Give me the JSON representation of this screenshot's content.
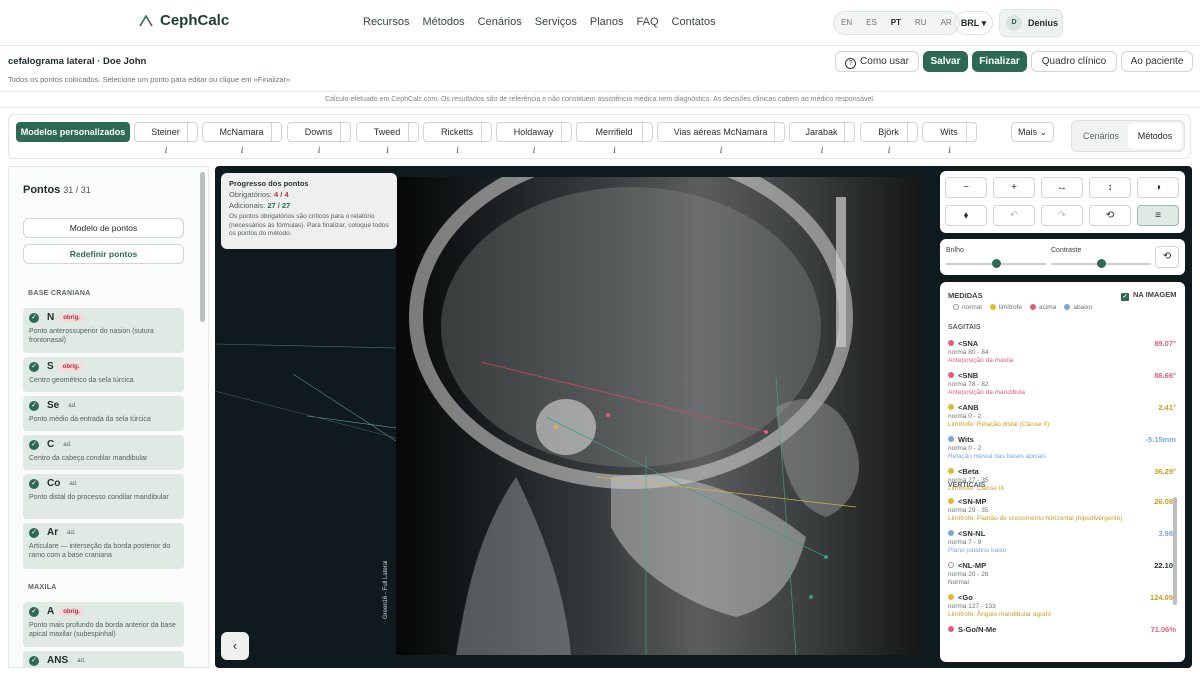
{
  "app": {
    "name": "CephCalc"
  },
  "nav": {
    "links": [
      "Recursos",
      "Métodos",
      "Cenários",
      "Serviços",
      "Planos",
      "FAQ",
      "Contatos"
    ]
  },
  "languages": [
    "EN",
    "ES",
    "PT",
    "RU",
    "AR"
  ],
  "active_language": "PT",
  "currency": "BRL ▾",
  "user": {
    "initial": "D",
    "name": "Denius"
  },
  "document": {
    "title": "cefalograma lateral · Doe John",
    "subtitle": "Todos os pontos colocados. Selecione um ponto para editar ou clique em «Finalizar»"
  },
  "actions": {
    "how_to": "Como usar",
    "save": "Salvar",
    "finish": "Finalizar",
    "clinical": "Quadro clínico",
    "patient": "Ao paciente"
  },
  "disclaimer": "Cálculo efetuado em CephCalc.com. Os resultados são de referência e não constituem assistência médica nem diagnóstico. As decisões clínicas cabem ao médico responsável.",
  "methods": {
    "custom": "Modelos personalizados",
    "info_glyph": "i",
    "items": [
      "Steiner",
      "McNamara",
      "Downs",
      "Tweed",
      "Ricketts",
      "Holdaway",
      "Merrifield",
      "Vias aéreas McNamara",
      "Jarabak",
      "Björk",
      "Wits"
    ],
    "more": "Mais ⌄",
    "toggle": [
      "Cenários",
      "Métodos"
    ],
    "toggle_active": "Métodos"
  },
  "sidebar": {
    "title": "Pontos",
    "count": "31 / 31",
    "model_button": "Modelo de pontos",
    "reset_button": "Redefinir pontos",
    "sections": [
      {
        "name": "BASE CRANIANA",
        "points": [
          {
            "code": "N",
            "tag": "obrig.",
            "required": true,
            "desc": "Ponto anterossuperior do nasion (sutura frontonasal)"
          },
          {
            "code": "S",
            "tag": "obrig.",
            "required": true,
            "desc": "Centro geométrico da sela túrcica"
          },
          {
            "code": "Se",
            "tag": "ad.",
            "required": false,
            "desc": "Ponto médio da entrada da sela túrcica"
          },
          {
            "code": "C",
            "tag": "ad.",
            "required": false,
            "desc": "Centro da cabeça condilar mandibular"
          },
          {
            "code": "Co",
            "tag": "ad.",
            "required": false,
            "desc": "Ponto distal do processo condilar mandibular"
          },
          {
            "code": "Ar",
            "tag": "ad.",
            "required": false,
            "desc": "Articulare — interseção da borda posterior do ramo com a base craniana"
          }
        ]
      },
      {
        "name": "MAXILA",
        "points": [
          {
            "code": "A",
            "tag": "obrig.",
            "required": true,
            "desc": "Ponto mais profundo da borda anterior da base apical maxilar (subespinhal)"
          },
          {
            "code": "ANS",
            "tag": "ad.",
            "required": false,
            "desc": ""
          }
        ]
      }
    ]
  },
  "progress": {
    "title": "Progresso dos pontos",
    "required_label": "Obrigatórios:",
    "required_value": "4 / 4",
    "additional_label": "Adicionais:",
    "additional_value": "27 / 27",
    "note": "Os pontos obrigatórios são críticos para o relatório (necessários às fórmulas). Para finalizar, coloque todos os pontos do método."
  },
  "image_label": "Green16 - Full Lateral",
  "tools": {
    "row1": [
      "−",
      "+",
      "↔",
      "↕",
      "◑"
    ],
    "row2": [
      "⬧",
      "↶",
      "↷",
      "⟲",
      "≡"
    ]
  },
  "adjust": {
    "brightness_label": "Brilho",
    "contrast_label": "Contraste",
    "brightness": 0.5,
    "contrast": 0.5,
    "reset": "⟲"
  },
  "measures": {
    "title": "MEDIDAS",
    "on_image": "NA IMAGEM",
    "legend": [
      {
        "label": "normal",
        "color": "#ffffff"
      },
      {
        "label": "limítrofe",
        "color": "#e3b92e"
      },
      {
        "label": "acima",
        "color": "#e0607a"
      },
      {
        "label": "abaixo",
        "color": "#7ea6d6"
      }
    ],
    "groups": [
      {
        "name": "SAGITAIS",
        "items": [
          {
            "name": "<SNA",
            "norm": "norma 80 - 84",
            "value": "89.07°",
            "status": "Anteposição da maxila",
            "color": "#e0607a"
          },
          {
            "name": "<SNB",
            "norm": "norma 78 - 82",
            "value": "86.66°",
            "status": "Anteposição da mandíbula",
            "color": "#e0607a"
          },
          {
            "name": "<ANB",
            "norm": "norma 0 - 2",
            "value": "2.41°",
            "status": "Limítrofe: Relação distal (Classe II)",
            "color": "#e3b92e"
          },
          {
            "name": "Wits",
            "norm": "norma 0 - 2",
            "value": "-5.15mm",
            "status": "Relação mesial das bases apicais",
            "color": "#7ea6d6"
          },
          {
            "name": "<Beta",
            "norm": "norma 27 - 35",
            "value": "36.29°",
            "status": "Limítrofe: Classe III",
            "color": "#e3b92e"
          }
        ]
      },
      {
        "name": "VERTICAIS",
        "items": [
          {
            "name": "<SN-MP",
            "norm": "norma 29 - 35",
            "value": "26.08°",
            "status": "Limítrofe: Padrão de crescimento horizontal (hipodivergente)",
            "color": "#e3b92e"
          },
          {
            "name": "<SN-NL",
            "norm": "norma 7 - 9",
            "value": "3.98°",
            "status": "Plano palatino baixo",
            "color": "#7ea6d6"
          },
          {
            "name": "<NL-MP",
            "norm": "norma 20 - 26",
            "value": "22.10°",
            "status": "Normal",
            "color": "#ffffff"
          },
          {
            "name": "<Go",
            "norm": "norma 127 - 133",
            "value": "124.09°",
            "status": "Limítrofe: Ângulo mandibular agudo",
            "color": "#e3b92e"
          },
          {
            "name": "S-Go/N-Me",
            "norm": "",
            "value": "71.06%",
            "status": "",
            "color": "#e0607a"
          }
        ]
      }
    ]
  },
  "colors": {
    "accent": "#2d6a55",
    "above": "#e0607a",
    "borderline": "#e3b92e",
    "below": "#7ea6d6"
  }
}
